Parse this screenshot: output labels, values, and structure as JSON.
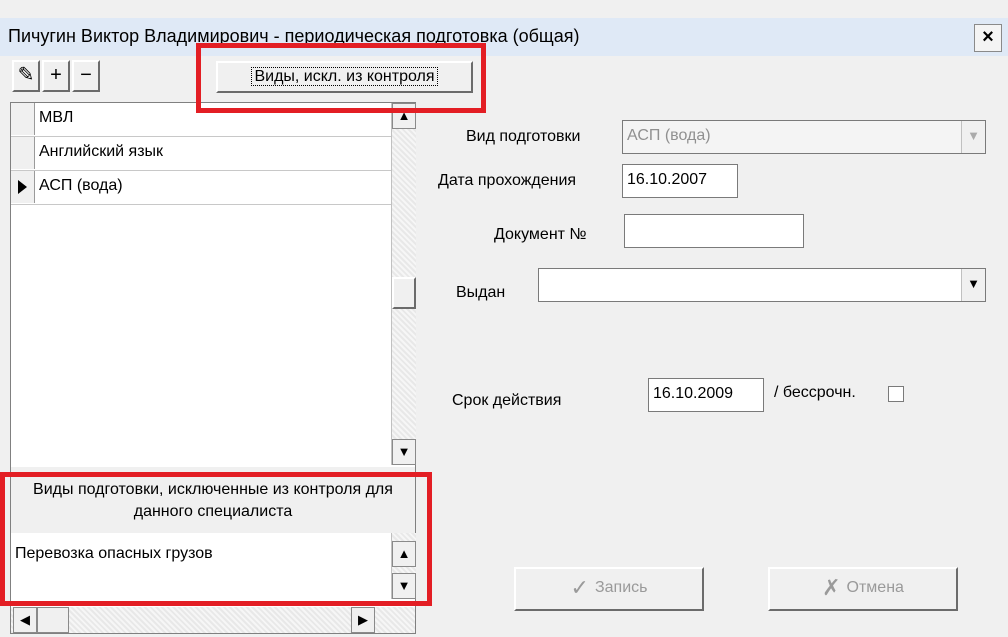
{
  "window": {
    "title": "Пичугин Виктор Владимирович - периодическая подготовка (общая)",
    "close": "×"
  },
  "toolbar": {
    "edit_icon": "✎",
    "add_icon": "+",
    "remove_icon": "−",
    "excluded_button": "Виды, искл. из контроля"
  },
  "training_list": {
    "rows": [
      {
        "name": "МВЛ",
        "current": false
      },
      {
        "name": "Английский язык",
        "current": false
      },
      {
        "name": "АСП (вода)",
        "current": true
      }
    ]
  },
  "excluded": {
    "header": "Виды подготовки, исключенные из контроля для данного специалиста",
    "items": [
      "Перевозка опасных грузов"
    ]
  },
  "form": {
    "training_type_label": "Вид подготовки",
    "training_type_value": "АСП (вода)",
    "date_label": "Дата прохождения",
    "date_value": "16.10.2007",
    "document_label": "Документ №",
    "document_value": "",
    "issued_label": "Выдан",
    "issued_value": "",
    "validity_label": "Срок действия",
    "validity_value": "16.10.2009",
    "indefinite_label": "/ бессрочн.",
    "indefinite_checked": false
  },
  "actions": {
    "save": "Запись",
    "cancel": "Отмена"
  },
  "colors": {
    "highlight_border": "#e31e24",
    "titlebar": "#dfe9f6"
  }
}
